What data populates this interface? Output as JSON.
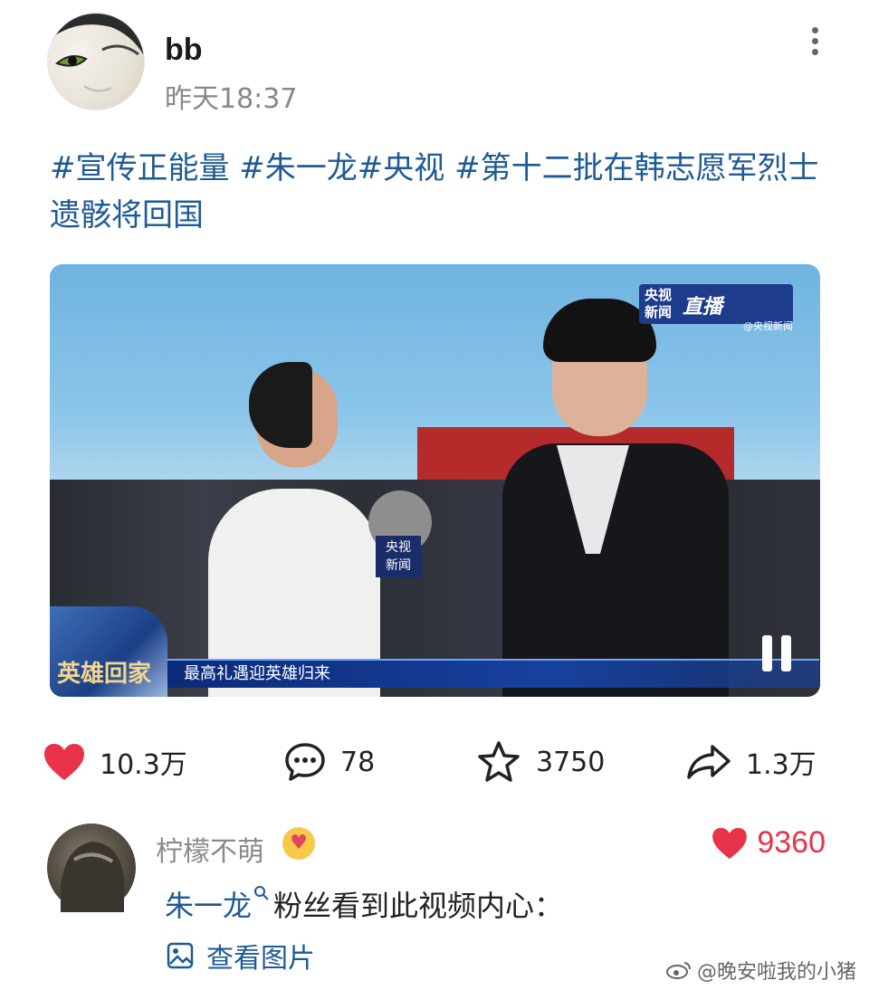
{
  "post": {
    "author": "bb",
    "time": "昨天18:37",
    "text": "#宣传正能量 #朱一龙#央视 #第十二批在韩志愿军烈士遗骸将回国"
  },
  "video": {
    "caption": "最高礼遇迎英雄归来",
    "emblem_text": "英雄回家",
    "logo_line1": "央视",
    "logo_line2": "新闻",
    "logo_brand": "直播",
    "logo_sub": "@央视新闻",
    "mic_flag_line1": "央视",
    "mic_flag_line2": "新闻",
    "state": "playing"
  },
  "actions": {
    "likes": "10.3万",
    "comments": "78",
    "favorites": "3750",
    "shares": "1.3万"
  },
  "top_comment": {
    "author": "柠檬不萌",
    "likes": "9360",
    "mention": "朱一龙",
    "text": "粉丝看到此视频内心：",
    "view_image_label": "查看图片"
  },
  "watermark": "@晚安啦我的小猪",
  "colors": {
    "link": "#1e5a96",
    "like_red": "#e8334a",
    "muted": "#888888"
  }
}
